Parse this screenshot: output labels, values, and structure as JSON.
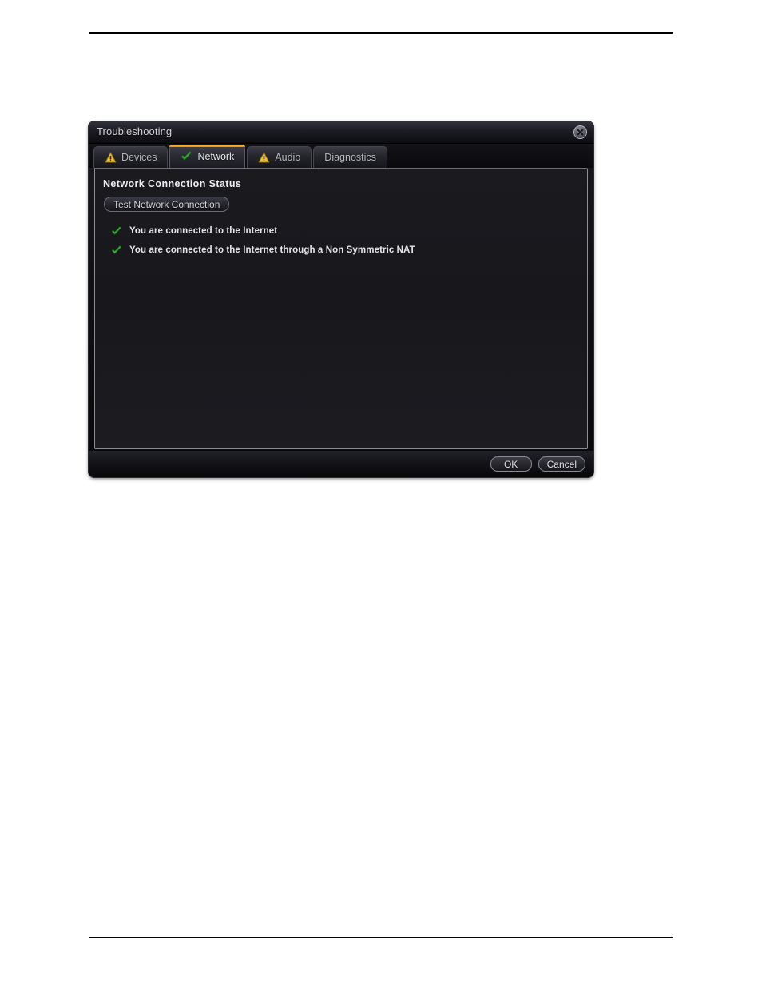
{
  "window": {
    "title": "Troubleshooting",
    "close_icon": "close-circle-icon"
  },
  "tabs": [
    {
      "label": "Devices",
      "icon": "warning-triangle-icon",
      "active": false
    },
    {
      "label": "Network",
      "icon": "green-check-icon",
      "active": true
    },
    {
      "label": "Audio",
      "icon": "warning-triangle-icon",
      "active": false
    },
    {
      "label": "Diagnostics",
      "icon": "none",
      "active": false
    }
  ],
  "content": {
    "section_title": "Network Connection Status",
    "test_button_label": "Test Network Connection",
    "status_items": [
      {
        "icon": "green-check-icon",
        "text": "You are connected to the Internet"
      },
      {
        "icon": "green-check-icon",
        "text": "You are connected to the Internet through a  Non Symmetric  NAT"
      }
    ]
  },
  "footer": {
    "ok_label": "OK",
    "cancel_label": "Cancel"
  },
  "colors": {
    "accent_orange": "#f39200",
    "warning_yellow": "#f2c230",
    "success_green": "#2fb42f",
    "dialog_bg": "#101014",
    "content_bg": "#18181d",
    "text_primary": "#e6e6ea"
  }
}
